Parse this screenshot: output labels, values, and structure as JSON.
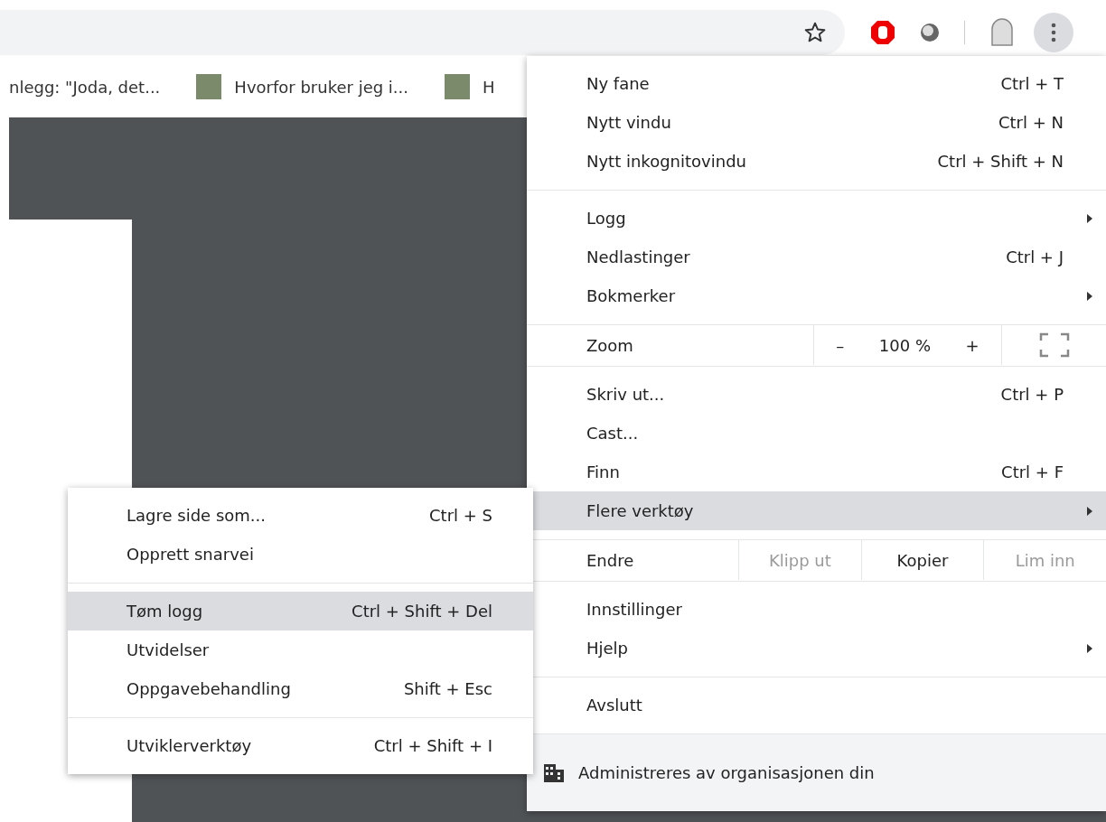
{
  "toolbar": {
    "menu_button_active": true
  },
  "bookmarks": [
    {
      "kind": "plain",
      "label": "nlegg: \"Joda, det..."
    },
    {
      "kind": "thumb",
      "label": "Hvorfor bruker jeg i..."
    },
    {
      "kind": "thumb",
      "label": "H"
    }
  ],
  "menu": {
    "sections": [
      {
        "items": [
          {
            "kind": "item",
            "label": "Ny fane",
            "shortcut": "Ctrl + T",
            "submenu": false,
            "highlighted": false
          },
          {
            "kind": "item",
            "label": "Nytt vindu",
            "shortcut": "Ctrl + N",
            "submenu": false,
            "highlighted": false
          },
          {
            "kind": "item",
            "label": "Nytt inkognitovindu",
            "shortcut": "Ctrl + Shift + N",
            "submenu": false,
            "highlighted": false
          }
        ]
      },
      {
        "items": [
          {
            "kind": "item",
            "label": "Logg",
            "submenu": true,
            "highlighted": false
          },
          {
            "kind": "item",
            "label": "Nedlastinger",
            "shortcut": "Ctrl + J",
            "submenu": false,
            "highlighted": false
          },
          {
            "kind": "item",
            "label": "Bokmerker",
            "submenu": true,
            "highlighted": false
          }
        ]
      },
      {
        "items": [
          {
            "kind": "zoom",
            "label": "Zoom",
            "minus": "–",
            "value": "100 %",
            "plus": "+"
          }
        ]
      },
      {
        "items": [
          {
            "kind": "item",
            "label": "Skriv ut...",
            "shortcut": "Ctrl + P",
            "submenu": false,
            "highlighted": false
          },
          {
            "kind": "item",
            "label": "Cast...",
            "submenu": false,
            "highlighted": false
          },
          {
            "kind": "item",
            "label": "Finn",
            "shortcut": "Ctrl + F",
            "submenu": false,
            "highlighted": false
          },
          {
            "kind": "item",
            "label": "Flere verktøy",
            "submenu": true,
            "highlighted": true
          }
        ]
      },
      {
        "items": [
          {
            "kind": "edit",
            "label": "Endre",
            "actions": [
              {
                "label": "Klipp ut",
                "disabled": true
              },
              {
                "label": "Kopier",
                "disabled": false
              },
              {
                "label": "Lim inn",
                "disabled": true
              }
            ]
          }
        ]
      },
      {
        "items": [
          {
            "kind": "item",
            "label": "Innstillinger",
            "submenu": false,
            "highlighted": false
          },
          {
            "kind": "item",
            "label": "Hjelp",
            "submenu": true,
            "highlighted": false
          }
        ]
      },
      {
        "items": [
          {
            "kind": "item",
            "label": "Avslutt",
            "submenu": false,
            "highlighted": false
          }
        ]
      }
    ],
    "footer": "Administreres av organisasjonen din"
  },
  "submenu": {
    "sections": [
      {
        "items": [
          {
            "label": "Lagre side som...",
            "shortcut": "Ctrl + S",
            "highlighted": false
          },
          {
            "label": "Opprett snarvei",
            "highlighted": false
          }
        ]
      },
      {
        "items": [
          {
            "label": "Tøm logg",
            "shortcut": "Ctrl + Shift + Del",
            "highlighted": true
          },
          {
            "label": "Utvidelser",
            "highlighted": false
          },
          {
            "label": "Oppgavebehandling",
            "shortcut": "Shift + Esc",
            "highlighted": false
          }
        ]
      },
      {
        "items": [
          {
            "label": "Utviklerverktøy",
            "shortcut": "Ctrl + Shift + I",
            "highlighted": false
          }
        ]
      }
    ]
  }
}
